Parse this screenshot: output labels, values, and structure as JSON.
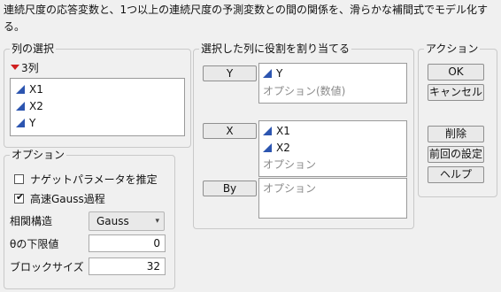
{
  "description": "連続尺度の応答変数と、1つ以上の連続尺度の予測変数との間の関係を、滑らかな補間式でモデル化する。",
  "column_selection": {
    "title": "列の選択",
    "count_label": "3列",
    "columns": [
      "X1",
      "X2",
      "Y"
    ]
  },
  "role_assignment": {
    "title": "選択した列に役割を割り当てる",
    "roles": [
      {
        "button": "Y",
        "values": [
          "Y"
        ],
        "hint": "オプション(数値)"
      },
      {
        "button": "X",
        "values": [
          "X1",
          "X2"
        ],
        "hint": "オプション"
      },
      {
        "button": "By",
        "values": [],
        "hint": "オプション"
      }
    ]
  },
  "actions": {
    "title": "アクション",
    "ok": "OK",
    "cancel": "キャンセル",
    "remove": "削除",
    "recall": "前回の設定",
    "help": "ヘルプ"
  },
  "options": {
    "title": "オプション",
    "nugget_label": "ナゲットパラメータを推定",
    "nugget_checked": false,
    "fast_gauss_label": "高速Gauss過程",
    "fast_gauss_checked": true,
    "correlation_label": "相関構造",
    "correlation_value": "Gauss",
    "theta_label": "θの下限値",
    "theta_value": "0",
    "block_label": "ブロックサイズ",
    "block_value": "32"
  },
  "colors": {
    "continuous_icon": "#2c55b0",
    "menu_triangle": "#d02020"
  }
}
